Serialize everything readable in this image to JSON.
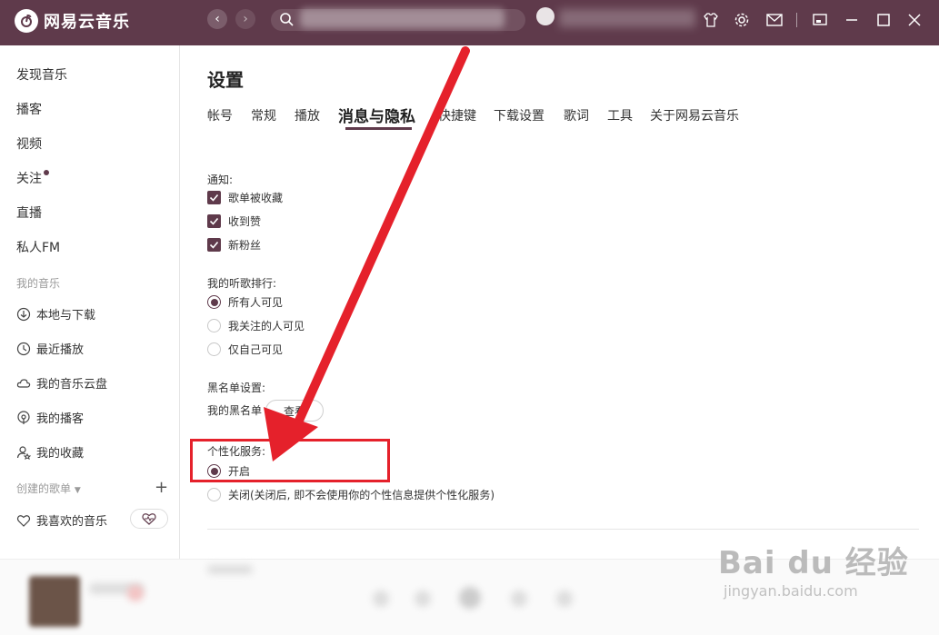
{
  "app": {
    "title": "网易云音乐"
  },
  "sidebar": {
    "items": [
      "发现音乐",
      "播客",
      "视频",
      "关注",
      "直播",
      "私人FM"
    ],
    "my_music_title": "我的音乐",
    "my_music_items": [
      "本地与下载",
      "最近播放",
      "我的音乐云盘",
      "我的播客",
      "我的收藏"
    ],
    "created_title": "创建的歌单",
    "favorites": "我喜欢的音乐"
  },
  "settings": {
    "title": "设置",
    "tabs": [
      "帐号",
      "常规",
      "播放",
      "消息与隐私",
      "快捷键",
      "下载设置",
      "歌词",
      "工具",
      "关于网易云音乐"
    ],
    "notify": {
      "label": "通知:",
      "options": [
        "歌单被收藏",
        "收到赞",
        "新粉丝"
      ]
    },
    "ranking": {
      "label": "我的听歌排行:",
      "options": [
        "所有人可见",
        "我关注的人可见",
        "仅自己可见"
      ],
      "selected": 0
    },
    "blacklist": {
      "label": "黑名单设置:",
      "sub_label": "我的黑名单",
      "button": "查看"
    },
    "personalized": {
      "label": "个性化服务:",
      "options": [
        "开启",
        "关闭(关闭后, 即不会使用你的个性信息提供个性化服务)"
      ],
      "selected": 0
    }
  },
  "watermark": {
    "brand": "Bai du 经验",
    "url": "jingyan.baidu.com"
  },
  "colors": {
    "accent": "#5f3a4b",
    "annotation": "#e5212b"
  }
}
